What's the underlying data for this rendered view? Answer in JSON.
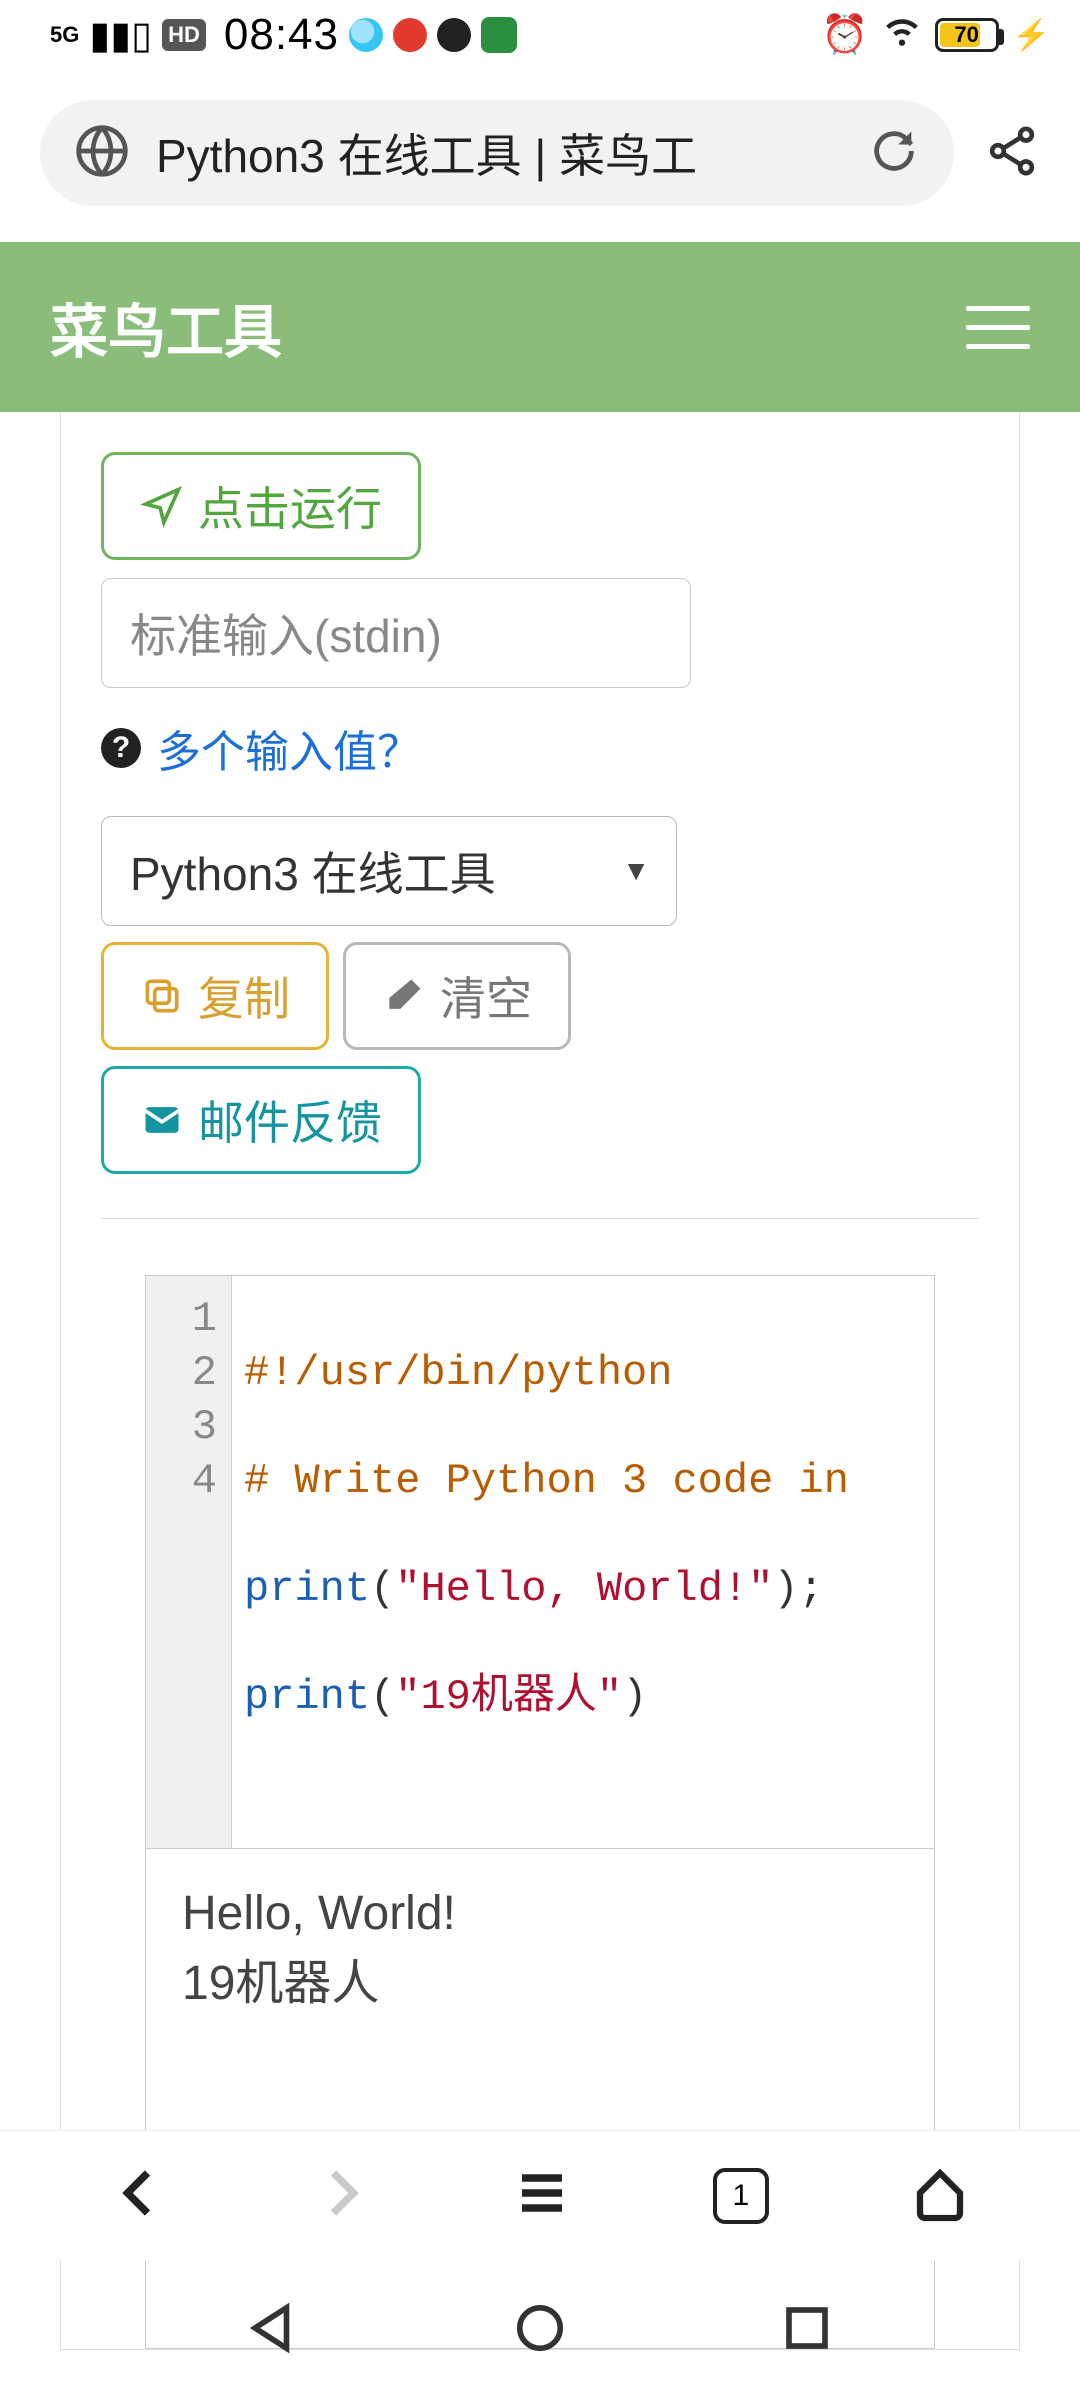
{
  "status": {
    "network": "5G",
    "signal_bars": 3,
    "hd": "HD",
    "time": "08:43",
    "battery_pct": "70"
  },
  "browser": {
    "page_title": "Python3 在线工具 | 菜鸟工",
    "tab_count": "1"
  },
  "site": {
    "title": "菜鸟工具"
  },
  "toolbar": {
    "run_label": "点击运行",
    "stdin_placeholder": "标准输入(stdin)",
    "help_link": "多个输入值？",
    "language_select": "Python3 在线工具",
    "copy_label": "复制",
    "clear_label": "清空",
    "feedback_label": "邮件反馈"
  },
  "editor": {
    "lines": [
      {
        "n": "1",
        "type": "comment",
        "text": "#!/usr/bin/python"
      },
      {
        "n": "2",
        "type": "comment",
        "text": "# Write Python 3 code in "
      },
      {
        "n": "3",
        "type": "print",
        "func": "print",
        "open": "(",
        "str": "\"Hello, World!\"",
        "close": ");"
      },
      {
        "n": "4",
        "type": "print",
        "func": "print",
        "open": "(",
        "str": "\"19机器人\"",
        "close": ")"
      }
    ]
  },
  "output": {
    "line1": "Hello, World!",
    "line2": "19机器人"
  }
}
